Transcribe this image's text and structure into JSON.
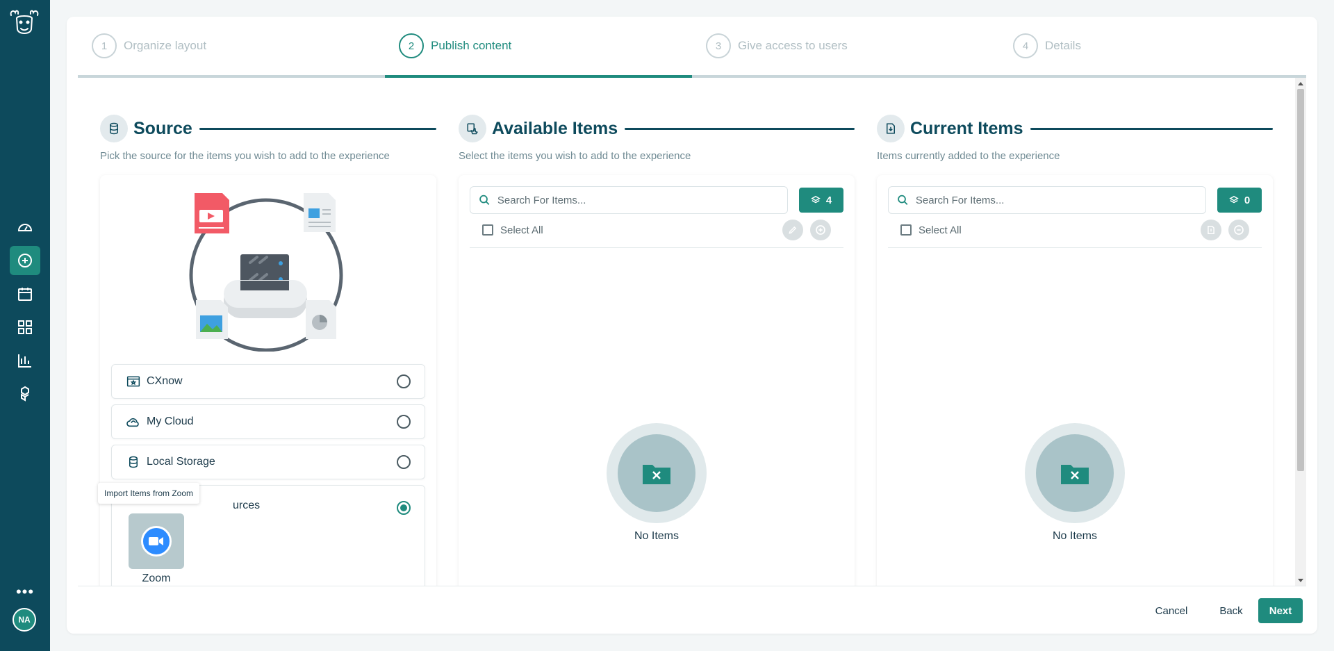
{
  "sidebar": {
    "avatar_initials": "NA",
    "more_label": "•••",
    "nav_items": [
      "dashboard",
      "create",
      "calendar",
      "apps",
      "analytics",
      "integrations"
    ]
  },
  "stepper": {
    "steps": [
      {
        "number": "1",
        "label": "Organize layout",
        "state": "inactive"
      },
      {
        "number": "2",
        "label": "Publish content",
        "state": "active"
      },
      {
        "number": "3",
        "label": "Give access to users",
        "state": "inactive"
      },
      {
        "number": "4",
        "label": "Details",
        "state": "inactive"
      }
    ]
  },
  "source": {
    "title": "Source",
    "subtitle": "Pick the source for the items you wish to add to the experience",
    "options": [
      {
        "label": "CXnow",
        "icon": "cxnow-icon",
        "selected": false
      },
      {
        "label": "My Cloud",
        "icon": "cloud-icon",
        "selected": false
      },
      {
        "label": "Local Storage",
        "icon": "database-icon",
        "selected": false
      },
      {
        "label": "External Resources",
        "icon": "external-icon",
        "selected": true
      }
    ],
    "tooltip": "Import Items from Zoom",
    "external_visible_label": "urces",
    "zoom_label": "Zoom"
  },
  "available": {
    "title": "Available Items",
    "subtitle": "Select the items you wish to add to the experience",
    "search_placeholder": "Search For Items...",
    "count": "4",
    "select_all": "Select All",
    "empty_text": "No Items"
  },
  "current": {
    "title": "Current Items",
    "subtitle": "Items currently added to the experience",
    "search_placeholder": "Search For Items...",
    "count": "0",
    "select_all": "Select All",
    "empty_text": "No Items"
  },
  "footer": {
    "cancel": "Cancel",
    "back": "Back",
    "next": "Next"
  },
  "colors": {
    "sidebar": "#0d4a5c",
    "accent": "#1f8b7e",
    "heading": "#0d4a5c"
  }
}
